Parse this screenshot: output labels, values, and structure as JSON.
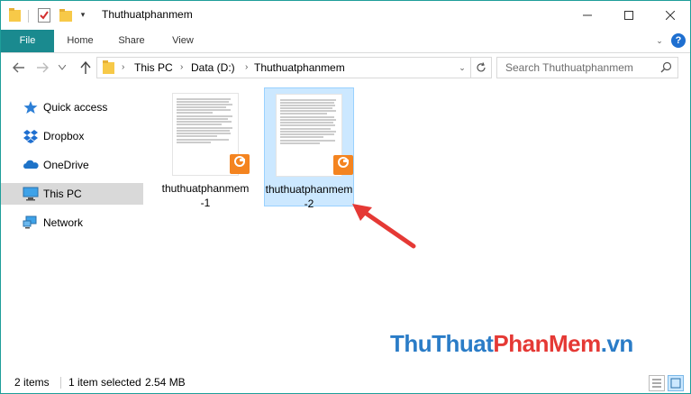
{
  "window": {
    "title": "Thuthuatphanmem"
  },
  "ribbon": {
    "tabs": [
      "File",
      "Home",
      "Share",
      "View"
    ]
  },
  "navbar": {
    "breadcrumb": [
      "This PC",
      "Data (D:)",
      "Thuthuatphanmem"
    ],
    "search_placeholder": "Search Thuthuatphanmem"
  },
  "sidebar": {
    "items": [
      {
        "label": "Quick access",
        "icon": "star-icon",
        "selected": false
      },
      {
        "label": "Dropbox",
        "icon": "dropbox-icon",
        "selected": false
      },
      {
        "label": "OneDrive",
        "icon": "onedrive-icon",
        "selected": false
      },
      {
        "label": "This PC",
        "icon": "this-pc-icon",
        "selected": true
      },
      {
        "label": "Network",
        "icon": "network-icon",
        "selected": false
      }
    ]
  },
  "files": [
    {
      "name": "thuthuatphanmem-1",
      "type": "pdf",
      "selected": false
    },
    {
      "name": "thuthuatphanmem-2",
      "type": "pdf",
      "selected": true
    }
  ],
  "watermark": {
    "part1": "ThuThuat",
    "part2": "PhanMem",
    "part3": ".vn"
  },
  "status": {
    "item_count": "2 items",
    "selection": "1 item selected",
    "size": "2.54 MB"
  },
  "colors": {
    "file_tab": "#1a8a8f",
    "selection_bg": "#cce8ff",
    "pdf_badge": "#f48420",
    "annotation_arrow": "#e53935"
  }
}
